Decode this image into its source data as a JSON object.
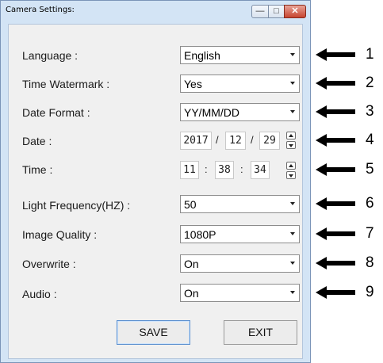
{
  "window": {
    "title": "Camera Settings:",
    "controls": {
      "minimize": "—",
      "maximize": "□",
      "close": "✕"
    }
  },
  "settings": [
    {
      "label": "Language :",
      "value": "English"
    },
    {
      "label": "Time Watermark :",
      "value": "Yes"
    },
    {
      "label": "Date Format :",
      "value": "YY/MM/DD"
    },
    {
      "label": "Date :",
      "year": "2017",
      "month": "12",
      "day": "29",
      "sep": "/"
    },
    {
      "label": "Time :",
      "hour": "11",
      "minute": "38",
      "second": "34",
      "sep": ":"
    },
    {
      "label": "Light Frequency(HZ) :",
      "value": "50"
    },
    {
      "label": "Image Quality :",
      "value": "1080P"
    },
    {
      "label": "Overwrite :",
      "value": "On"
    },
    {
      "label": "Audio :",
      "value": "On"
    }
  ],
  "buttons": {
    "save": "SAVE",
    "exit": "EXIT"
  },
  "callouts": [
    "1",
    "2",
    "3",
    "4",
    "5",
    "6",
    "7",
    "8",
    "9"
  ]
}
